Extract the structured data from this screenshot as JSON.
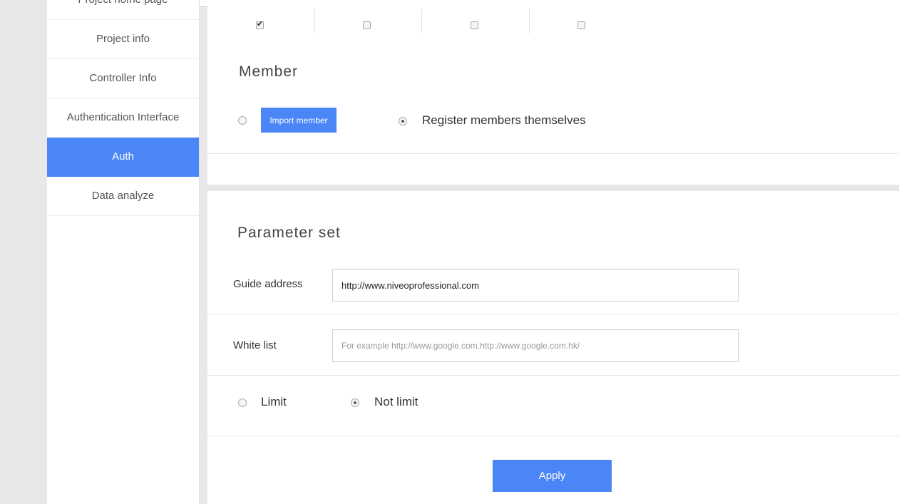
{
  "sidebar": {
    "items": [
      {
        "label": "Project home page",
        "active": false
      },
      {
        "label": "Project info",
        "active": false
      },
      {
        "label": "Controller Info",
        "active": false
      },
      {
        "label": "Authentication Interface",
        "active": false
      },
      {
        "label": "Auth",
        "active": true
      },
      {
        "label": "Data analyze",
        "active": false
      }
    ]
  },
  "permissions_row": {
    "checkboxes": [
      true,
      false,
      false,
      false
    ]
  },
  "member": {
    "title": "Member",
    "import_button": "Import member",
    "register_label": "Register members themselves",
    "selected": "register"
  },
  "parameters": {
    "title": "Parameter set",
    "guide_address_label": "Guide address",
    "guide_address_value": "http://www.niveoprofessional.com",
    "white_list_label": "White list",
    "white_list_placeholder": "For example http://www.google.com,http://www.google.com.hk/",
    "white_list_value": "",
    "limit_label": "Limit",
    "not_limit_label": "Not limit",
    "limit_selected": "not_limit"
  },
  "actions": {
    "apply_label": "Apply"
  },
  "colors": {
    "accent": "#4a86f5"
  }
}
